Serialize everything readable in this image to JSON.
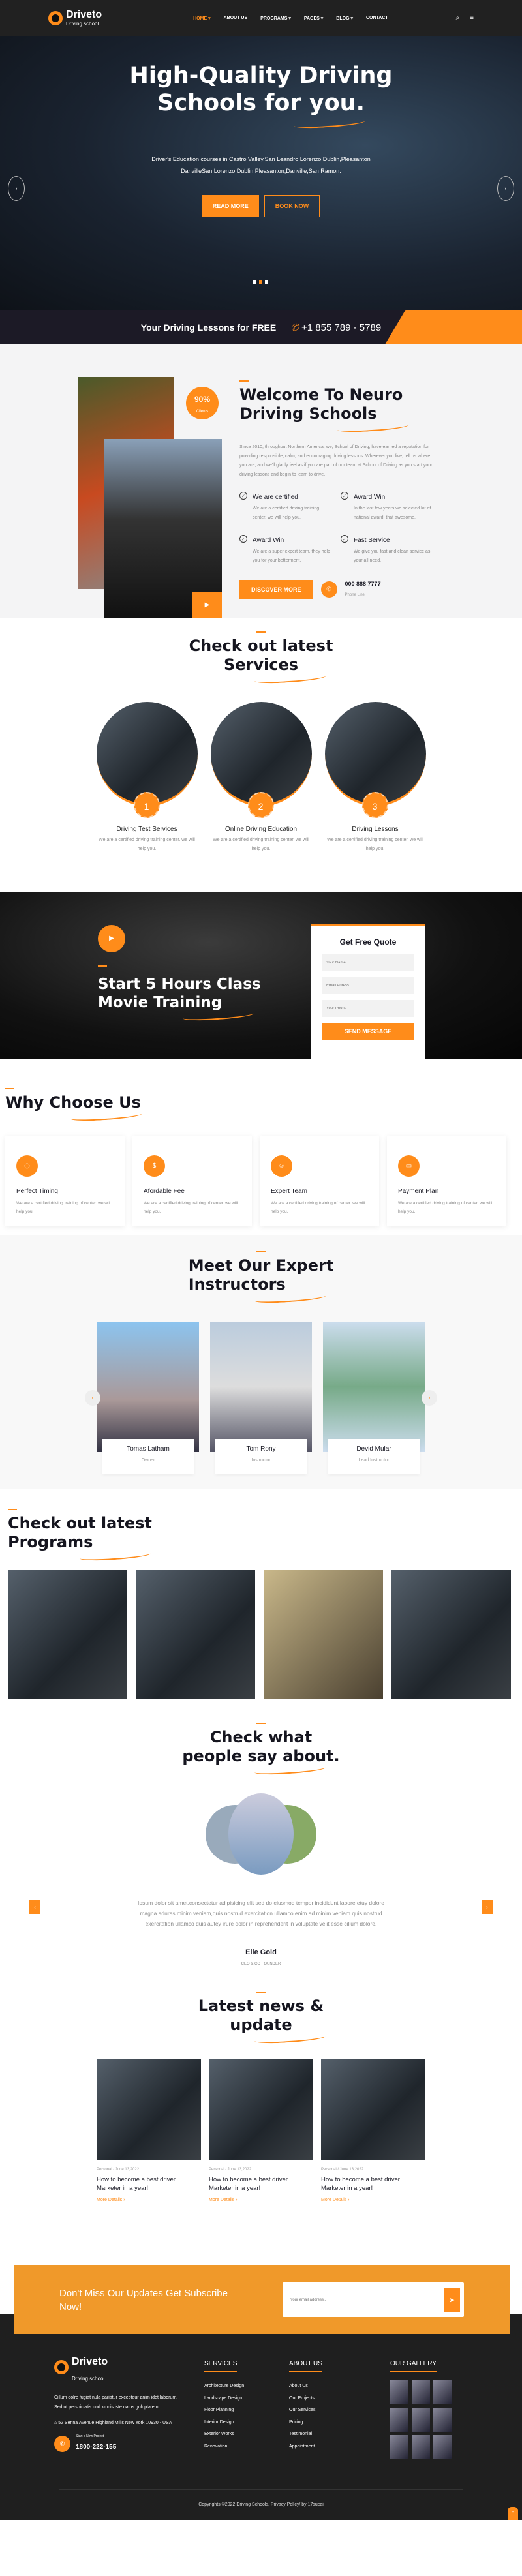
{
  "brand": {
    "name": "Driveto",
    "tagline": "Driving school"
  },
  "nav": {
    "items": [
      "HOME ▾",
      "ABOUT US",
      "PROGRAMS ▾",
      "PAGES ▾",
      "BLOG ▾",
      "CONTACT"
    ],
    "search_icon": "⌕",
    "menu_icon": "≡"
  },
  "hero": {
    "title_line1": "High-Quality Driving",
    "title_line2": "Schools for you.",
    "text": "Driver's Education courses in Castro Valley,San Leandro,Lorenzo,Dublin,Pleasanton DanvilleSan Lorenzo,Dublin,Pleasanton,Danville,San Ramon.",
    "read_more": "READ MORE",
    "book_now": "BOOK NOW",
    "prev": "‹",
    "next": "›",
    "active_slide": 2
  },
  "freebar": {
    "text": "Your Driving Lessons for FREE",
    "phone_icon": "✆",
    "phone": "+1 855 789 - 5789"
  },
  "welcome": {
    "badge_value": "90%",
    "badge_label": "Clients",
    "title_line1": "Welcome To Neuro",
    "title_line2": "Driving Schools",
    "lead": "Since 2010, throughout Northern America, we, School of Driving, have earned a reputation for providing responsible, calm, and encouraging driving lessons. Wherever you live, tell us where you are, and we'll gladly feel as if you are part of our team at School of Driving as you start your driving lessons and begin to learn to drive.",
    "features": [
      {
        "title": "We are certified",
        "text": "We are a certified driving training center. we will help you."
      },
      {
        "title": "Award Win",
        "text": "In the last few years we selected lot of national award. that awesome."
      },
      {
        "title": "Award Win",
        "text": "We are a super expert team. they help you for your betterment."
      },
      {
        "title": "Fast Service",
        "text": "We give you fast and clean service as your all need."
      }
    ],
    "button": "DISCOVER MORE",
    "phone": "000 888 7777",
    "phone_label": "Phone Line",
    "play_icon": "▶"
  },
  "services": {
    "title_line1": "Check out latest",
    "title_line2": "Services",
    "items": [
      {
        "num": "1",
        "title": "Driving Test Services",
        "text": "We are a certified driving training center. we will help you."
      },
      {
        "num": "2",
        "title": "Online Driving Education",
        "text": "We are a certified driving training center. we will help you."
      },
      {
        "num": "3",
        "title": "Driving Lessons",
        "text": "We are a certified driving training center. we will help you."
      }
    ]
  },
  "quote": {
    "title_line1": "Start 5 Hours Class",
    "title_line2": "Movie Training",
    "play_icon": "▶",
    "form_title": "Get Free Quote",
    "name_ph": "Your Name",
    "email_ph": "Email Adress",
    "phone_ph": "Your Phone",
    "button": "SEND MESSAGE"
  },
  "why": {
    "title": "Why Choose Us",
    "items": [
      {
        "title": "Perfect Timing",
        "text": "We are a certified driving training of center. we will help you."
      },
      {
        "title": "Afordable Fee",
        "text": "We are a certified driving training of center. we will help you."
      },
      {
        "title": "Expert Team",
        "text": "We are a certified driving training of center. we will help you."
      },
      {
        "title": "Payment Plan",
        "text": "We are a certified driving training of center. we will help you."
      }
    ]
  },
  "team": {
    "title_line1": "Meet Our Expert",
    "title_line2": "Instructors",
    "members": [
      {
        "name": "Tomas Latham",
        "role": "Owner"
      },
      {
        "name": "Tom Rony",
        "role": "Instructor"
      },
      {
        "name": "Devid Mular",
        "role": "Lead Instructor"
      }
    ]
  },
  "programs": {
    "title_line1": "Check out latest",
    "title_line2": "Programs"
  },
  "testimonials": {
    "title_line1": "Check what",
    "title_line2": "people say about.",
    "quote": "Ipsum dolor sit amet,consectetur adipisicing elit sed do eiusmod tempor incididunt labore etuy dolore magna aduras minim veniam,quis nostrud exercitation ullamco enim ad minim veniam quis nostrud exercitation ullamco duis autey irure dolor in reprehenderit in voluptate velit esse cillum dolore.",
    "name": "Elle Gold",
    "role": "CEO & CO FOUNDER"
  },
  "news": {
    "title_line1": "Latest news &",
    "title_line2": "update",
    "posts": [
      {
        "meta": "Personal / June 13,2022",
        "title": "How to become a best driver Marketer in a year!",
        "link": "More Details ›"
      },
      {
        "meta": "Personal / June 13,2022",
        "title": "How to become a best driver Marketer in a year!",
        "link": "More Details ›"
      },
      {
        "meta": "Personal / June 13,2022",
        "title": "How to become a best driver Marketer in a year!",
        "link": "More Details ›"
      }
    ]
  },
  "subscribe": {
    "title": "Don't Miss Our Updates Get Subscribe Now!",
    "placeholder": "Your email address..",
    "send_icon": "➤"
  },
  "footer": {
    "about": "Cillum dolre fugiat nula pariatur excepteur anim idet laborum. Sed ut perspiciatis und kmnis iste natus goluptatem.",
    "address": "52 Serina Avenue,Highland Mills New York 10930 - USA",
    "project_label": "Start a New Project",
    "project_phone": "1800-222-155",
    "services_title": "SERVICES",
    "services": [
      "Architecture Design",
      "Landscape Design",
      "Floor Planning",
      "Interior Design",
      "Exterior Works",
      "Renovation"
    ],
    "about_title": "ABOUT US",
    "about_links": [
      "About Us",
      "Our Projects",
      "Our Services",
      "Pricing",
      "Testimonial",
      "Appointment"
    ],
    "gallery_title": "OUR GALLERY",
    "copyright": "Copyrights ©2022 Driving Schools. Privacy Policy/ by 17sucai",
    "social": [
      "f",
      "t",
      "in",
      "◎",
      "▶"
    ],
    "to_top": "^"
  },
  "colors": {
    "accent": "#ff8c1a",
    "dark": "#212121",
    "heading": "#15151f"
  }
}
